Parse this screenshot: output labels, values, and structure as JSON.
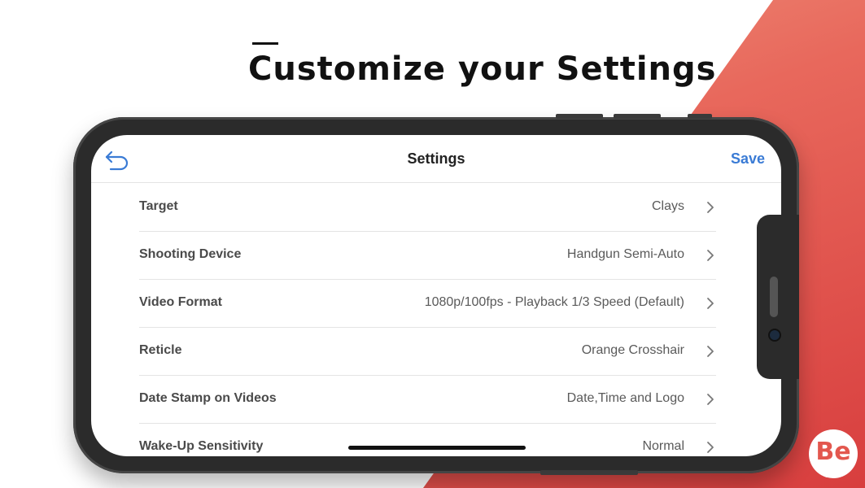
{
  "headline": "Customize your Settings",
  "navbar": {
    "title": "Settings",
    "save_label": "Save",
    "back_icon": "undo-arrow-icon",
    "accent_color": "#3a7bd5"
  },
  "settings": [
    {
      "label": "Target",
      "value": "Clays"
    },
    {
      "label": "Shooting Device",
      "value": "Handgun Semi-Auto"
    },
    {
      "label": "Video Format",
      "value": "1080p/100fps - Playback 1/3 Speed (Default)"
    },
    {
      "label": "Reticle",
      "value": "Orange Crosshair"
    },
    {
      "label": "Date Stamp on Videos",
      "value": "Date,Time and Logo"
    },
    {
      "label": "Wake-Up Sensitivity",
      "value": "Normal"
    }
  ],
  "brand_logo": {
    "text": "Be",
    "color": "#e3574e"
  }
}
